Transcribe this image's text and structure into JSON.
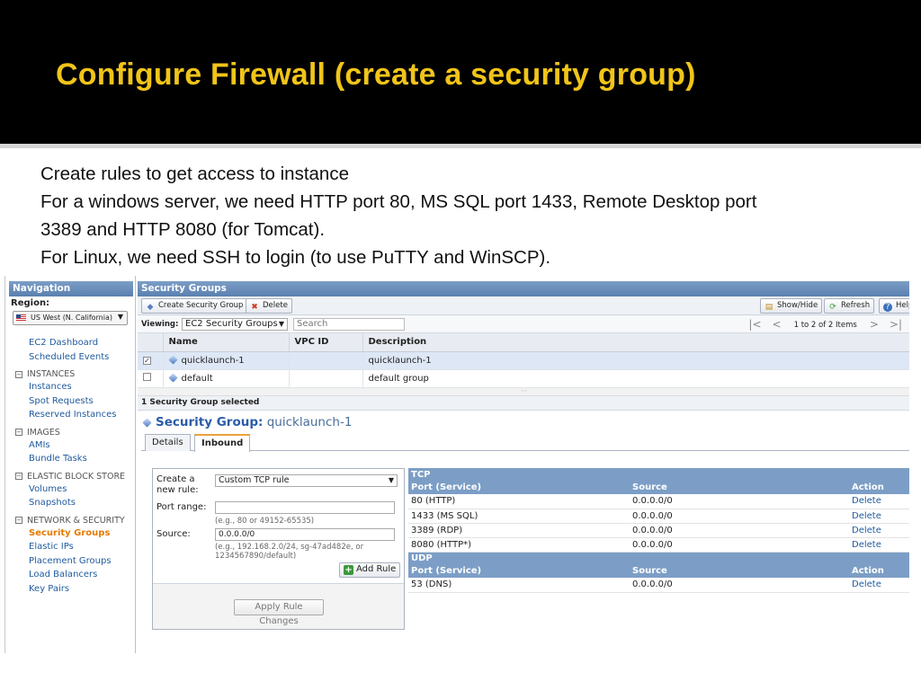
{
  "slide": {
    "title": "Configure Firewall (create a security group)",
    "lines": [
      "Create rules to get access to instance",
      "For a windows server, we need HTTP port 80, MS SQL port 1433, Remote Desktop port",
      "3389 and HTTP 8080 (for Tomcat).",
      "For Linux, we need SSH to login (to use PuTTY and WinSCP)."
    ]
  },
  "nav": {
    "title": "Navigation",
    "region_label": "Region:",
    "region_value": "US West (N. California)",
    "top_links": [
      "EC2 Dashboard",
      "Scheduled Events"
    ],
    "sections": [
      {
        "title": "INSTANCES",
        "links": [
          "Instances",
          "Spot Requests",
          "Reserved Instances"
        ]
      },
      {
        "title": "IMAGES",
        "links": [
          "AMIs",
          "Bundle Tasks"
        ]
      },
      {
        "title": "ELASTIC BLOCK STORE",
        "links": [
          "Volumes",
          "Snapshots"
        ]
      },
      {
        "title": "NETWORK & SECURITY",
        "links": [
          "Security Groups",
          "Elastic IPs",
          "Placement Groups",
          "Load Balancers",
          "Key Pairs"
        ]
      }
    ],
    "active": "Security Groups"
  },
  "main": {
    "title": "Security Groups",
    "toolbar": {
      "create": "Create Security Group",
      "delete": "Delete",
      "showhide": "Show/Hide",
      "refresh": "Refresh",
      "help": "Help"
    },
    "viewing_label": "Viewing:",
    "viewing_value": "EC2 Security Groups",
    "search_placeholder": "Search",
    "pager_text": "1 to 2 of 2 Items",
    "columns": [
      "Name",
      "VPC ID",
      "Description"
    ],
    "rows": [
      {
        "name": "quicklaunch-1",
        "vpc": "",
        "desc": "quicklaunch-1",
        "checked": true
      },
      {
        "name": "default",
        "vpc": "",
        "desc": "default group",
        "checked": false
      }
    ],
    "selected_bar": "1 Security Group selected",
    "sg_label": "Security Group:",
    "sg_name": "quicklaunch-1",
    "tabs": [
      "Details",
      "Inbound"
    ],
    "active_tab": "Inbound"
  },
  "rule_form": {
    "create_label_1": "Create a",
    "create_label_2": "new rule:",
    "create_value": "Custom TCP rule",
    "port_label": "Port range:",
    "port_value": "",
    "port_hint": "(e.g., 80 or 49152-65535)",
    "source_label": "Source:",
    "source_value": "0.0.0.0/0",
    "source_hint_1": "(e.g., 192.168.2.0/24, sg-47ad482e, or",
    "source_hint_2": "1234567890/default)",
    "add_rule": "Add Rule",
    "apply": "Apply Rule Changes"
  },
  "rules": {
    "tcp": {
      "label": "TCP",
      "headers": [
        "Port (Service)",
        "Source",
        "Action"
      ],
      "rows": [
        {
          "port": "80 (HTTP)",
          "source": "0.0.0.0/0",
          "action": "Delete"
        },
        {
          "port": "1433 (MS SQL)",
          "source": "0.0.0.0/0",
          "action": "Delete"
        },
        {
          "port": "3389 (RDP)",
          "source": "0.0.0.0/0",
          "action": "Delete"
        },
        {
          "port": "8080 (HTTP*)",
          "source": "0.0.0.0/0",
          "action": "Delete"
        }
      ]
    },
    "udp": {
      "label": "UDP",
      "headers": [
        "Port (Service)",
        "Source",
        "Action"
      ],
      "rows": [
        {
          "port": "53 (DNS)",
          "source": "0.0.0.0/0",
          "action": "Delete"
        }
      ]
    }
  }
}
